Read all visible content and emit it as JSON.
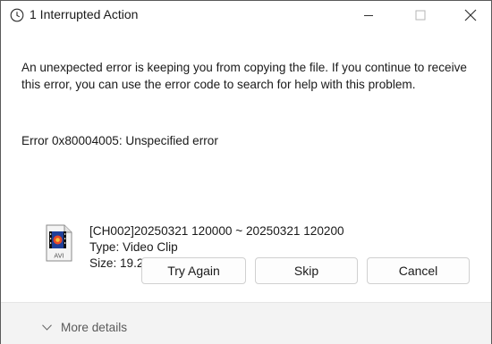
{
  "window": {
    "title": "1 Interrupted Action",
    "controls": {
      "minimize_icon": "minimize-icon",
      "maximize_icon": "maximize-icon",
      "close_icon": "close-icon"
    }
  },
  "message": {
    "body": "An unexpected error is keeping you from copying the file. If you continue to receive this error, you can use the error code to search for help with this problem.",
    "error_code": "Error 0x80004005: Unspecified error"
  },
  "file": {
    "icon": "avi-video-file-icon",
    "icon_label": "AVI",
    "name": "[CH002]20250321 120000 ~ 20250321 120200",
    "type": "Type: Video Clip",
    "size": "Size: 19.2 MB"
  },
  "buttons": {
    "try_again": "Try Again",
    "skip": "Skip",
    "cancel": "Cancel"
  },
  "footer": {
    "more_details": "More details",
    "chevron_icon": "chevron-down-icon"
  },
  "colors": {
    "text": "#1a1a1a",
    "muted_text": "#5a5a5a",
    "footer_bg": "#f3f3f3",
    "button_border": "#d0d0d0"
  }
}
